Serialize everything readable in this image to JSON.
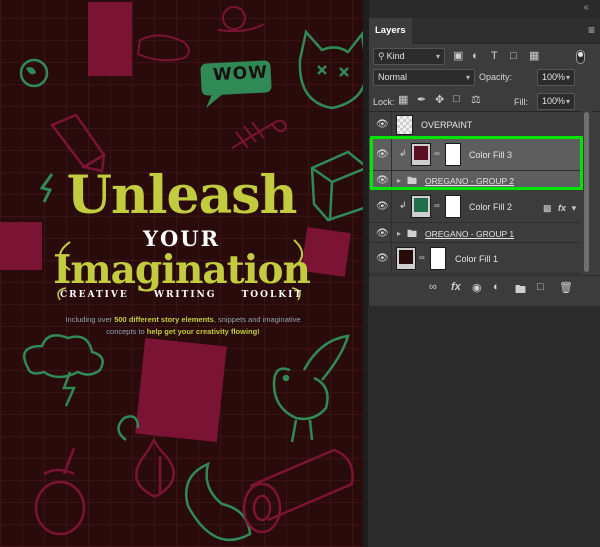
{
  "poster": {
    "bubble_text": "WOW",
    "title_line1": "Unleash",
    "title_line2": "YOUR",
    "title_line3": "Imagination",
    "subtitle": "CREATIVE WRITING TOOLKIT",
    "description_part1": "Including over ",
    "description_bold1": "500 different story elements",
    "description_part2": ", snippets and imaginative concepts to ",
    "description_bold2": "help get your creativity flowing!",
    "colors": {
      "background": "#2a0b0b",
      "title": "#c3cc3e",
      "shape": "#7a1334",
      "doodle_green": "#2f8a55"
    }
  },
  "panel": {
    "collapse_icon": "double-chevron-icon",
    "tab": "Layers",
    "menu_icon": "hamburger-menu-icon",
    "filter": {
      "kind": "Kind"
    },
    "blend_mode": "Normal",
    "opacity_label": "Opacity:",
    "opacity_value": "100%",
    "lock_label": "Lock:",
    "fill_label": "Fill:",
    "fill_value": "100%",
    "layers": [
      {
        "name": "OVERPAINT",
        "type": "pixel"
      },
      {
        "name": "Color Fill 3",
        "type": "fill",
        "color": "#5b0f22",
        "selected": true
      },
      {
        "name": "OREGANO - GROUP 2",
        "type": "group",
        "selected": true
      },
      {
        "name": "Color Fill 2",
        "type": "fill",
        "color": "#1f6e4c"
      },
      {
        "name": "OREGANO - GROUP 1",
        "type": "group"
      },
      {
        "name": "Color Fill 1",
        "type": "fill",
        "color": "#2a0b0b"
      }
    ],
    "highlight_color": "#00e400"
  }
}
